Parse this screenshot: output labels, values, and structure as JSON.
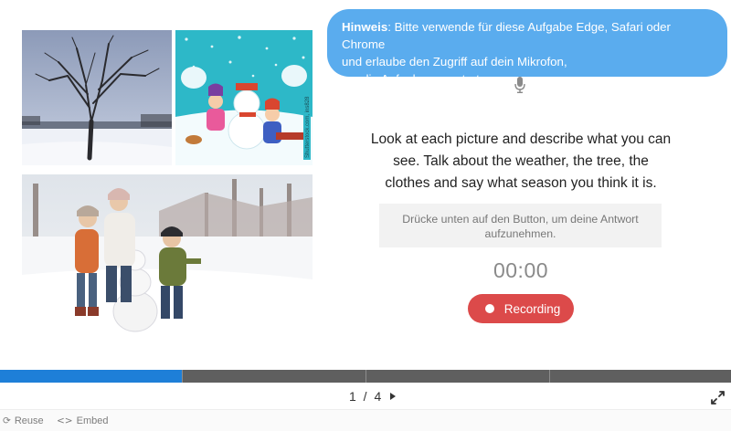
{
  "hint": {
    "label": "Hinweis",
    "text_rest": ": Bitte verwende für diese Aufgabe Edge, Safari oder Chrome",
    "line2": "und erlaube den Zugriff auf dein Mikrofon,",
    "line3": "um die Aufnahme zu starten."
  },
  "task": {
    "prompt": "Look at each picture and describe what you can see. Talk about the weather, the tree, the clothes and say what season you think it is.",
    "answer_hint": "Drücke unten auf den Button, um deine Antwort aufzunehmen.",
    "timer": "00:00",
    "record_label": "Recording"
  },
  "images": {
    "cartoon_credit": "Shutterstock.com, ins828"
  },
  "progress": {
    "current": 1,
    "total": 4
  },
  "pager": {
    "text": "1 / 4"
  },
  "footer": {
    "reuse_label": "Reuse",
    "embed_label": "Embed"
  },
  "colors": {
    "hint_bg": "#5aacee",
    "record_button": "#dc4a4a",
    "progress_fill": "#1e7fd8",
    "progress_track": "#5f5f5f"
  },
  "icons": {
    "mic": "microphone-icon",
    "next": "arrow-right-icon",
    "fullscreen": "expand-icon",
    "reuse": "refresh-icon",
    "embed": "code-icon"
  }
}
